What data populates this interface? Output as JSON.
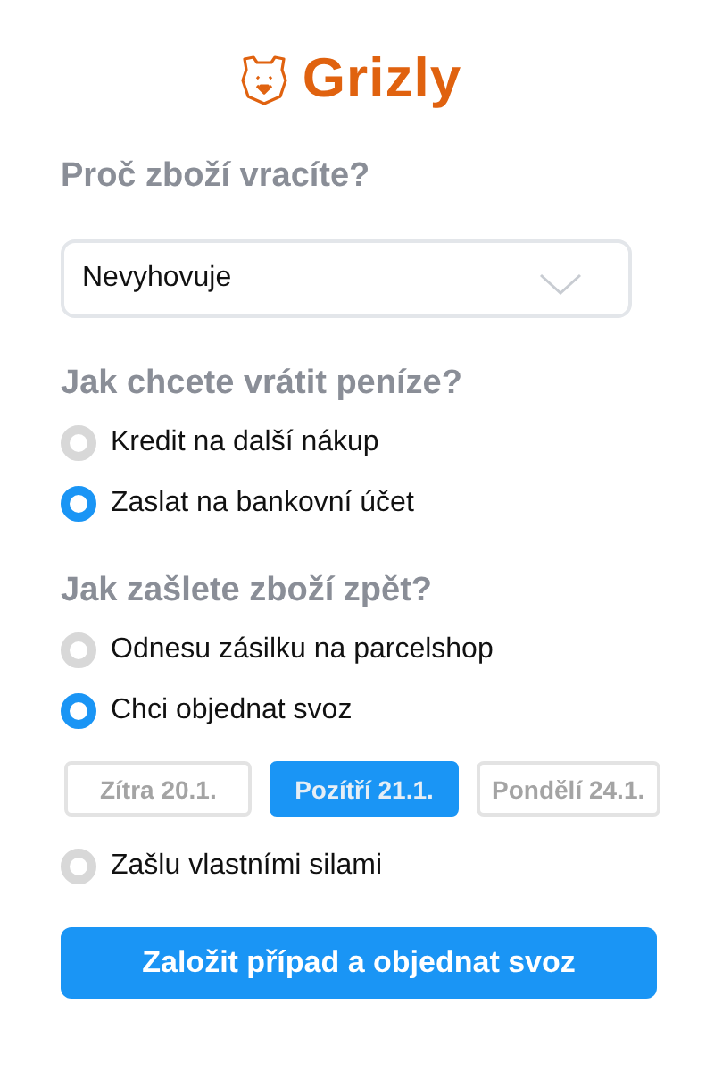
{
  "logo": {
    "text": "Grizly"
  },
  "reason": {
    "heading": "Proč zboží vracíte?",
    "value": "Nevyhovuje"
  },
  "refund": {
    "heading": "Jak chcete vrátit peníze?",
    "options": [
      {
        "label": "Kredit na další nákup",
        "selected": false
      },
      {
        "label": "Zaslat na bankovní účet",
        "selected": true
      }
    ]
  },
  "shipping": {
    "heading": "Jak zašlete zboží zpět?",
    "options": [
      {
        "label": "Odnesu zásilku na parcelshop",
        "selected": false
      },
      {
        "label": "Chci objednat svoz",
        "selected": true,
        "dates": [
          {
            "label": "Zítra 20.1.",
            "selected": false
          },
          {
            "label": "Pozítří 21.1.",
            "selected": true
          },
          {
            "label": "Pondělí 24.1.",
            "selected": false
          }
        ]
      },
      {
        "label": "Zašlu vlastními silami",
        "selected": false
      }
    ]
  },
  "submit": {
    "label": "Založit případ a objednat svoz"
  }
}
